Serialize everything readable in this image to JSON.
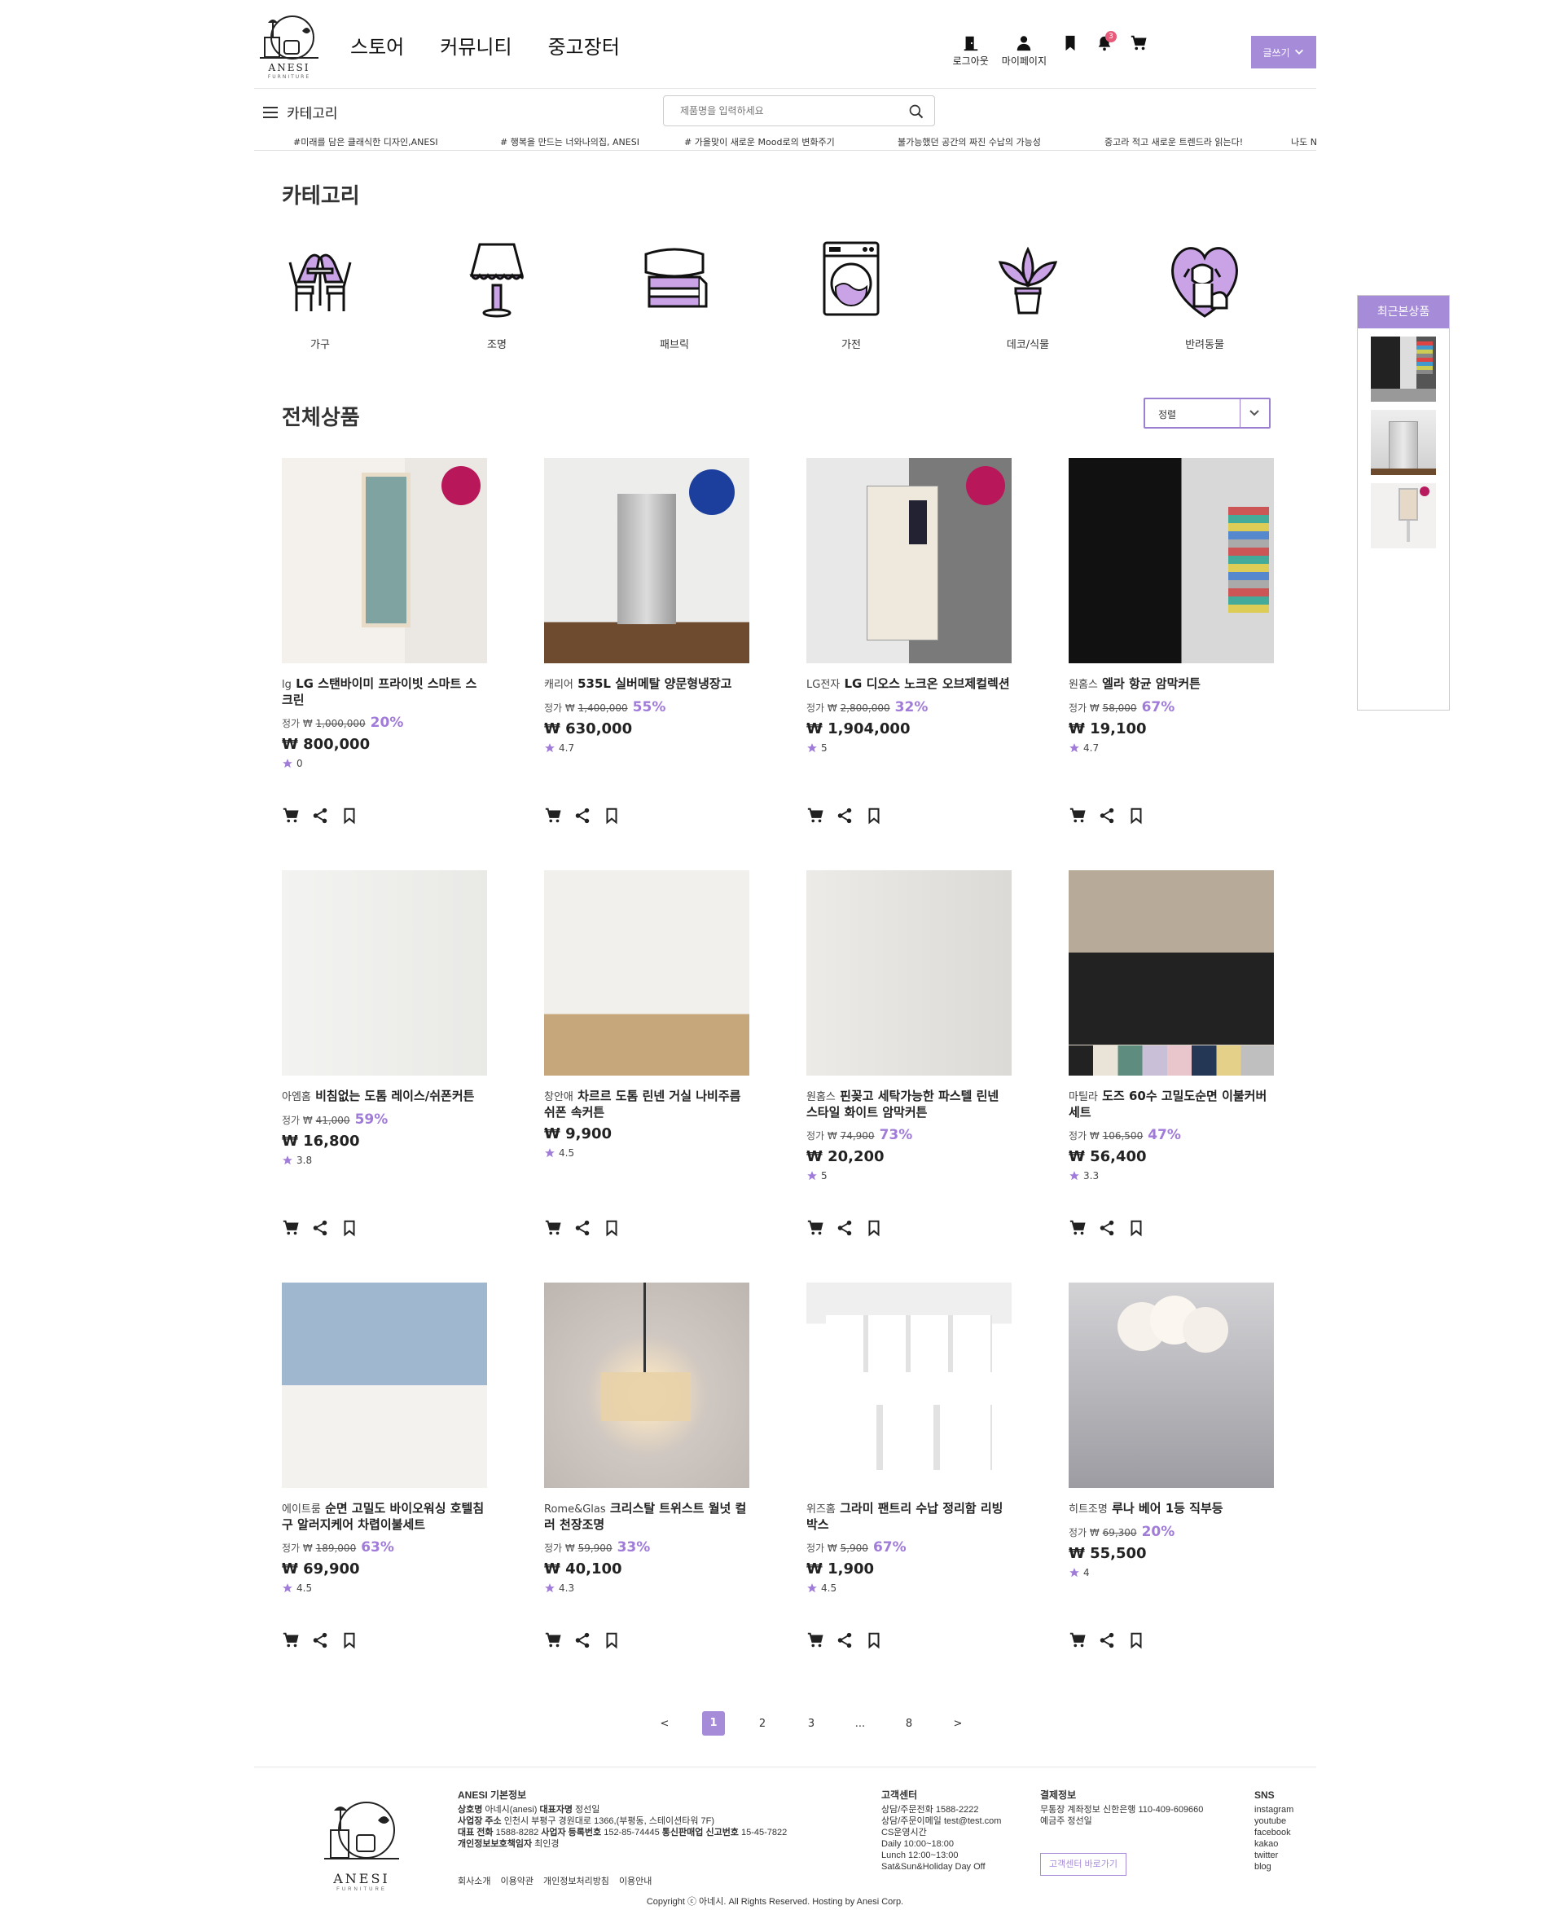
{
  "header": {
    "logo_name": "ANESI",
    "logo_sub": "FURNITURE",
    "nav": [
      "스토어",
      "커뮤니티",
      "중고장터"
    ],
    "util": {
      "logout": "로그아웃",
      "mypage": "마이페이지",
      "notif_count": "3"
    },
    "write_label": "글쓰기",
    "category_label": "카테고리",
    "search_placeholder": "제품명을 입력하세요"
  },
  "ticker": [
    "#미래를 담은 클래식한 디자인,ANESI",
    "# 행복을 만드는 너와나의집, ANESI",
    "# 가을맞이 새로운 Mood로의 변화주기",
    "불가능했던 공간의 짜진 수납의 가능성",
    "중고라 적고 새로운 트렌드라 읽는다!",
    "나도 N"
  ],
  "category_section": {
    "title": "카테고리",
    "items": [
      {
        "label": "가구",
        "icon": "furniture-icon"
      },
      {
        "label": "조명",
        "icon": "lamp-icon"
      },
      {
        "label": "패브릭",
        "icon": "fabric-icon"
      },
      {
        "label": "가전",
        "icon": "washer-icon"
      },
      {
        "label": "데코/식물",
        "icon": "plant-icon"
      },
      {
        "label": "반려동물",
        "icon": "pet-icon"
      }
    ]
  },
  "products_section": {
    "title": "전체상품",
    "sort_label": "정렬",
    "price_prefix": "정가 ₩ "
  },
  "products": [
    {
      "brand": "lg",
      "name": "LG 스탠바이미 프라이빗 스마트 스크린",
      "orig": "1,000,000",
      "disc": "20%",
      "price": "₩ 800,000",
      "rating": "0"
    },
    {
      "brand": "캐리어",
      "name": "535L 실버메탈 양문형냉장고",
      "orig": "1,400,000",
      "disc": "55%",
      "price": "₩ 630,000",
      "rating": "4.7"
    },
    {
      "brand": "LG전자",
      "name": "LG 디오스 노크온 오브제컬렉션",
      "orig": "2,800,000",
      "disc": "32%",
      "price": "₩ 1,904,000",
      "rating": "5"
    },
    {
      "brand": "원홈스",
      "name": "엘라 항균 암막커튼",
      "orig": "58,000",
      "disc": "67%",
      "price": "₩ 19,100",
      "rating": "4.7"
    },
    {
      "brand": "아엠홈",
      "name": "비침없는 도톰 레이스/쉬폰커튼",
      "orig": "41,000",
      "disc": "59%",
      "price": "₩ 16,800",
      "rating": "3.8"
    },
    {
      "brand": "창안애",
      "name": "차르르 도톰 린넨 거실 나비주름 쉬폰 속커튼",
      "orig": "",
      "disc": "",
      "price": "₩ 9,900",
      "rating": "4.5"
    },
    {
      "brand": "원홈스",
      "name": "핀꽂고 세탁가능한 파스텔 린넨 스타일 화이트 암막커튼",
      "orig": "74,900",
      "disc": "73%",
      "price": "₩ 20,200",
      "rating": "5"
    },
    {
      "brand": "마틸라",
      "name": "도즈 60수 고밀도순면 이불커버세트",
      "orig": "106,500",
      "disc": "47%",
      "price": "₩ 56,400",
      "rating": "3.3"
    },
    {
      "brand": "에이트룸",
      "name": "순면 고밀도 바이오워싱 호텔침구 알러지케어 차렵이불세트",
      "orig": "189,000",
      "disc": "63%",
      "price": "₩ 69,900",
      "rating": "4.5"
    },
    {
      "brand": "Rome&Glas",
      "name": "크리스탈 트위스트 월넛 컬러 천장조명",
      "orig": "59,900",
      "disc": "33%",
      "price": "₩ 40,100",
      "rating": "4.3"
    },
    {
      "brand": "위즈홈",
      "name": "그라미 팬트리 수납 정리함 리빙박스",
      "orig": "5,900",
      "disc": "67%",
      "price": "₩ 1,900",
      "rating": "4.5"
    },
    {
      "brand": "히트조명",
      "name": "루나 베어 1등 직부등",
      "orig": "69,300",
      "disc": "20%",
      "price": "₩ 55,500",
      "rating": "4"
    }
  ],
  "pagination": [
    "<",
    "1",
    "2",
    "3",
    "...",
    "8",
    ">"
  ],
  "recent": {
    "title": "최근본상품"
  },
  "footer": {
    "info_title": "ANESI 기본정보",
    "info_lines": [
      [
        "상호명",
        " 아네시(anesi) ",
        "대표자명",
        " 정선일"
      ],
      [
        "사업장 주소",
        " 인천시 부평구 경원대로 1366,(부평동, 스테이션타워 7F)",
        "",
        ""
      ],
      [
        "대표 전화",
        " 1588-8282 ",
        "사업자 등록번호",
        " 152-85-74445 "
      ],
      [
        "개인정보보호책임자",
        " 최인경",
        "",
        ""
      ]
    ],
    "info_extra": "통신판매업 신고번호",
    "info_extra_val": " 15-45-7822",
    "links": [
      "회사소개",
      "이용약관",
      "개인정보처리방침",
      "이용안내"
    ],
    "cs_title": "고객센터",
    "cs_lines": [
      "상담/주문전화 1588-2222",
      "상담/주문이메일 test@test.com",
      "CS운영시간",
      "Daily 10:00~18:00",
      "Lunch 12:00~13:00",
      "Sat&Sun&Holiday Day Off"
    ],
    "pay_title": "결제정보",
    "pay_lines": [
      "무통장 계좌정보 신한은행 110-409-609660",
      "예금주 정선일"
    ],
    "cs_button": "고객센터 바로가기",
    "sns_title": "SNS",
    "sns": [
      "instagram",
      "youtube",
      "facebook",
      "kakao",
      "twitter",
      "blog"
    ],
    "copyright": "Copyright ⓒ 아네시. All Rights Reserved. Hosting by Anesi Corp."
  },
  "colors": {
    "accent": "#a68bd8",
    "accent_text": "#a07bd8",
    "badge": "#e85a7a"
  }
}
